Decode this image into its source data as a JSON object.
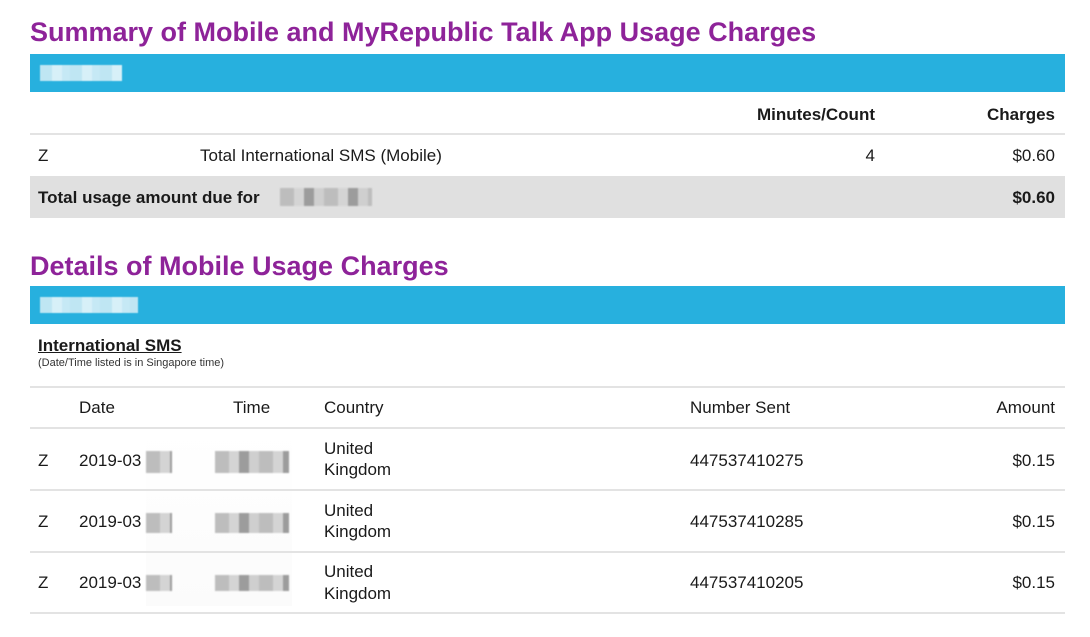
{
  "summary": {
    "title": "Summary of Mobile and MyRepublic Talk App Usage Charges",
    "headers": {
      "minutes": "Minutes/Count",
      "charges": "Charges"
    },
    "row": {
      "code": "Z",
      "description": "Total International SMS (Mobile)",
      "count": "4",
      "charge": "$0.60"
    },
    "total_label": "Total usage amount due for",
    "total_value": "$0.60"
  },
  "details": {
    "title": "Details of Mobile Usage Charges",
    "section": "International SMS",
    "note": "(Date/Time listed is in Singapore time)",
    "headers": {
      "date": "Date",
      "time": "Time",
      "country": "Country",
      "number": "Number Sent",
      "amount": "Amount"
    },
    "rows": [
      {
        "code": "Z",
        "date": "2019-03",
        "country_line1": "United",
        "country_line2": "Kingdom",
        "number": "447537410275",
        "amount": "$0.15"
      },
      {
        "code": "Z",
        "date": "2019-03",
        "country_line1": "United",
        "country_line2": "Kingdom",
        "number": "447537410285",
        "amount": "$0.15"
      },
      {
        "code": "Z",
        "date": "2019-03",
        "country_line1": "United",
        "country_line2": "Kingdom",
        "number": "447537410205",
        "amount": "$0.15"
      }
    ]
  },
  "colors": {
    "title": "#8e2399",
    "bar": "#27b0de",
    "total_bg": "#e0e0e0"
  }
}
